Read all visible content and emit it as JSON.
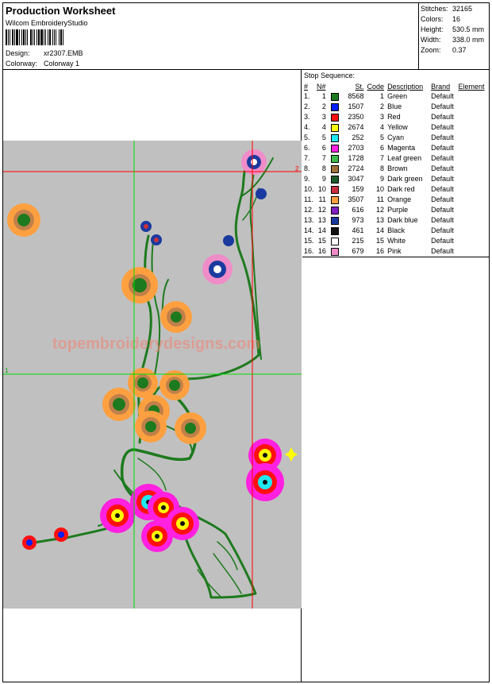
{
  "header": {
    "title": "Production Worksheet",
    "software": "Wilcom EmbroideryStudio",
    "design_label": "Design:",
    "design_value": "xr2307.EMB",
    "colorway_label": "Colorway:",
    "colorway_value": "Colorway 1"
  },
  "stats": [
    {
      "label": "Stitches:",
      "value": "32165"
    },
    {
      "label": "Colors:",
      "value": "16"
    },
    {
      "label": "Height:",
      "value": "530.5 mm"
    },
    {
      "label": "Width:",
      "value": "338.0 mm"
    },
    {
      "label": "Zoom:",
      "value": "0.37"
    }
  ],
  "design": {
    "watermark": "topembroiderydesigns.com",
    "marker_h": "2",
    "marker_v": "1",
    "background_color": "#c0c0c0"
  },
  "sequence": {
    "title": "Stop Sequence:",
    "headers": {
      "idx": "#",
      "num": "N#",
      "st": "St.",
      "code": "Code",
      "desc": "Description",
      "brand": "Brand",
      "element": "Element"
    },
    "rows": [
      {
        "idx": "1.",
        "num": "1",
        "color": "#1e7a1e",
        "st": "8568",
        "code": "1",
        "desc": "Green",
        "brand": "Default"
      },
      {
        "idx": "2.",
        "num": "2",
        "color": "#0020ff",
        "st": "1507",
        "code": "2",
        "desc": "Blue",
        "brand": "Default"
      },
      {
        "idx": "3.",
        "num": "3",
        "color": "#ff1010",
        "st": "2350",
        "code": "3",
        "desc": "Red",
        "brand": "Default"
      },
      {
        "idx": "4.",
        "num": "4",
        "color": "#ffff00",
        "st": "2674",
        "code": "4",
        "desc": "Yellow",
        "brand": "Default"
      },
      {
        "idx": "5.",
        "num": "5",
        "color": "#20e8f0",
        "st": "252",
        "code": "5",
        "desc": "Cyan",
        "brand": "Default"
      },
      {
        "idx": "6.",
        "num": "6",
        "color": "#ff20e0",
        "st": "2703",
        "code": "6",
        "desc": "Magenta",
        "brand": "Default"
      },
      {
        "idx": "7.",
        "num": "7",
        "color": "#3cb84c",
        "st": "1728",
        "code": "7",
        "desc": "Leaf green",
        "brand": "Default"
      },
      {
        "idx": "8.",
        "num": "8",
        "color": "#a0703c",
        "st": "2724",
        "code": "8",
        "desc": "Brown",
        "brand": "Default"
      },
      {
        "idx": "9.",
        "num": "9",
        "color": "#1a5a2a",
        "st": "3047",
        "code": "9",
        "desc": "Dark green",
        "brand": "Default"
      },
      {
        "idx": "10.",
        "num": "10",
        "color": "#c83040",
        "st": "159",
        "code": "10",
        "desc": "Dark red",
        "brand": "Default"
      },
      {
        "idx": "11.",
        "num": "11",
        "color": "#ffa040",
        "st": "3507",
        "code": "11",
        "desc": "Orange",
        "brand": "Default"
      },
      {
        "idx": "12.",
        "num": "12",
        "color": "#8020c0",
        "st": "616",
        "code": "12",
        "desc": "Purple",
        "brand": "Default"
      },
      {
        "idx": "13.",
        "num": "13",
        "color": "#1a3aa0",
        "st": "973",
        "code": "13",
        "desc": "Dark blue",
        "brand": "Default"
      },
      {
        "idx": "14.",
        "num": "14",
        "color": "#101010",
        "st": "461",
        "code": "14",
        "desc": "Black",
        "brand": "Default"
      },
      {
        "idx": "15.",
        "num": "15",
        "color": "#ffffff",
        "st": "215",
        "code": "15",
        "desc": "White",
        "brand": "Default"
      },
      {
        "idx": "16.",
        "num": "16",
        "color": "#f08cc8",
        "st": "679",
        "code": "16",
        "desc": "Pink",
        "brand": "Default"
      }
    ]
  }
}
